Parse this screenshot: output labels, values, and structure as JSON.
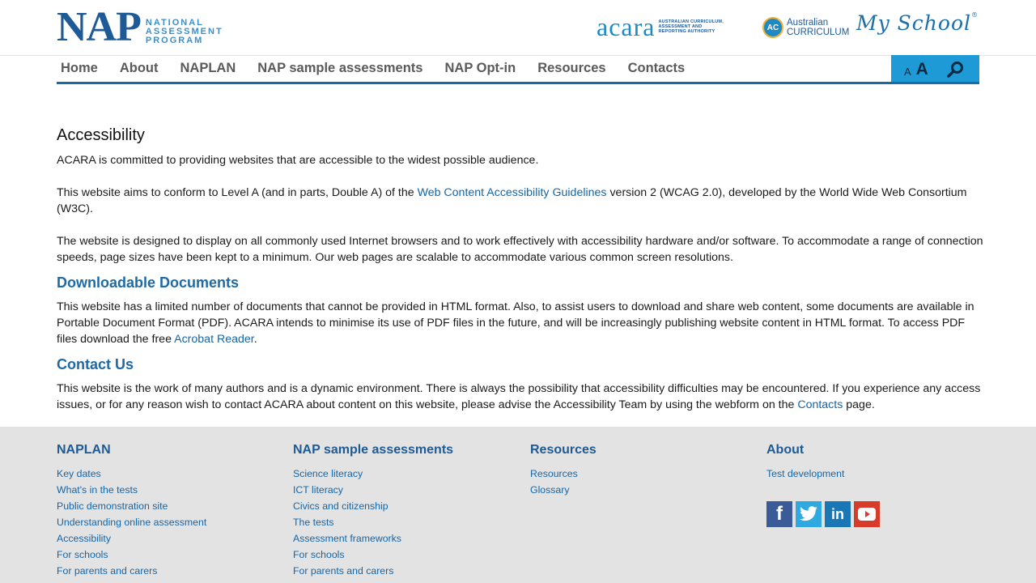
{
  "header": {
    "nap_logo": {
      "letters": "NAP",
      "line1": "NATIONAL",
      "line2": "ASSESSMENT",
      "line3": "PROGRAM"
    },
    "acara_logo": {
      "word": "acara",
      "tag1": "AUSTRALIAN CURRICULUM,",
      "tag2": "ASSESSMENT AND",
      "tag3": "REPORTING AUTHORITY"
    },
    "ac_logo": {
      "badge": "AC",
      "line1": "Australian",
      "line2": "CURRICULUM"
    },
    "myschool_logo": {
      "text": "My School",
      "mark": "®"
    }
  },
  "nav": {
    "items": [
      "Home",
      "About",
      "NAPLAN",
      "NAP sample assessments",
      "NAP Opt-in",
      "Resources",
      "Contacts"
    ],
    "font_small": "A",
    "font_large": "A"
  },
  "content": {
    "title": "Accessibility",
    "p1": "ACARA is committed to providing websites that are accessible to the widest possible audience.",
    "p2_before": "This website aims to conform to Level A (and in parts, Double A) of the ",
    "p2_link": "Web Content Accessibility Guidelines",
    "p2_after": " version 2 (WCAG 2.0), developed by the World Wide Web Consortium (W3C).",
    "p3": "The website is designed to display on all commonly used Internet browsers and to work effectively with accessibility hardware and/or software. To accommodate a range of connection speeds, page sizes have been kept to a minimum. Our web pages are scalable to accommodate various common screen resolutions.",
    "h_downloads": "Downloadable Documents",
    "p4_before": "This website has a limited number of documents that cannot be provided in HTML format. Also, to assist users to download and share web content, some documents are available in Portable Document Format (PDF). ACARA intends to minimise its use of PDF files in the future, and will be increasingly publishing website content in HTML format. To access PDF files download the free ",
    "p4_link": "Acrobat Reader",
    "p4_after": ".",
    "h_contact": "Contact Us",
    "p5_before": "This website is the work of many authors and is a dynamic environment. There is always the possibility that accessibility difficulties may be encountered. If you experience any access issues, or for any reason wish to contact ACARA about content on this website, please advise the Accessibility Team by using the webform on the ",
    "p5_link": "Contacts",
    "p5_after": " page."
  },
  "footer": {
    "col1": {
      "title": "NAPLAN",
      "links": [
        "Key dates",
        "What's in the tests",
        "Public demonstration site",
        "Understanding online assessment",
        "Accessibility",
        "For schools",
        "For parents and carers"
      ]
    },
    "col2": {
      "title": "NAP sample assessments",
      "links": [
        "Science literacy",
        "ICT literacy",
        "Civics and citizenship",
        "The tests",
        "Assessment frameworks",
        "For schools",
        "For parents and carers"
      ]
    },
    "col3": {
      "title": "Resources",
      "links": [
        "Resources",
        "Glossary"
      ]
    },
    "col4": {
      "title": "About",
      "links": [
        "Test development"
      ]
    },
    "social": {
      "facebook": "f",
      "linkedin": "in"
    },
    "colors": {
      "facebook": "#3b5a98",
      "twitter": "#2fa9e0",
      "linkedin": "#1a77b6",
      "youtube": "#d93b2b"
    }
  }
}
